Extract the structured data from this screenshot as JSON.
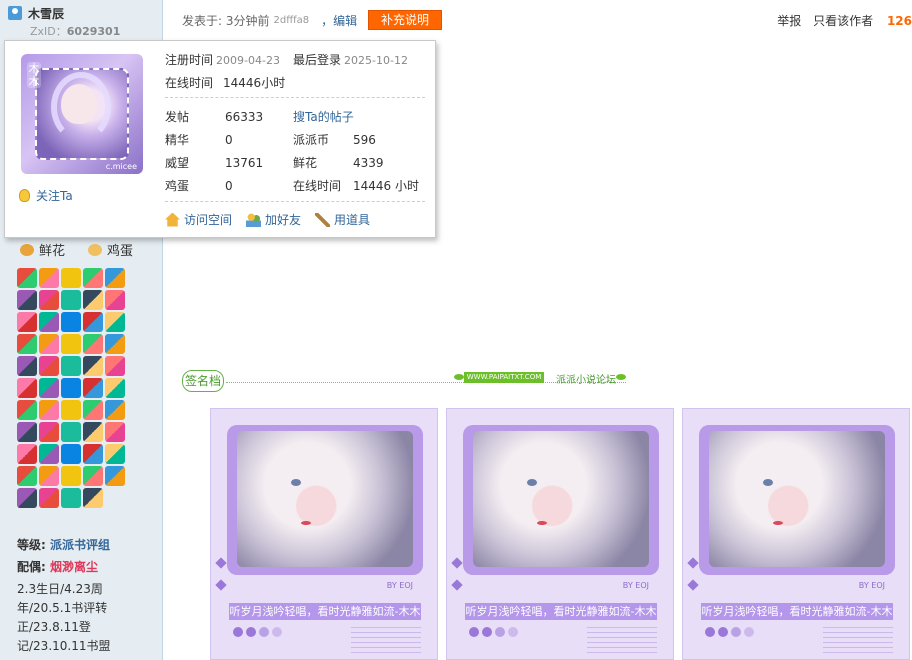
{
  "user": {
    "name": "木雪辰",
    "zxid_label": "ZxID：",
    "zxid": "6029301",
    "avatar_text": "木木",
    "avatar_caption": "c.micee",
    "follow": "关注Ta"
  },
  "profile_card": {
    "reg_label": "注册时间",
    "reg_date": "2009-04-23",
    "last_label": "最后登录",
    "last_date": "2025-10-12",
    "online_label": "在线时间",
    "online_value": "14446小时",
    "stats": [
      {
        "label": "发帖",
        "value": "66333"
      },
      {
        "label": "精华",
        "value": "0"
      },
      {
        "label": "威望",
        "value": "13761"
      },
      {
        "label": "鸡蛋",
        "value": "0"
      },
      {
        "label": "搜Ta的帖子",
        "value": ""
      },
      {
        "label": "派派币",
        "value": "596"
      },
      {
        "label": "鲜花",
        "value": "4339"
      },
      {
        "label": "在线时间",
        "value": "14446 小时"
      }
    ],
    "actions": {
      "space": "访问空间",
      "friend": "加好友",
      "tool": "用道具"
    }
  },
  "sidebar": {
    "flower": "鲜花",
    "egg": "鸡蛋",
    "level_label": "等级: ",
    "level_value": "派派书评组",
    "mate_label": "配偶: ",
    "mate_value": "烟渺离尘",
    "bio": "2.3生日/4.23周年/20.5.1书评转正/23.8.11登记/23.10.11书盟"
  },
  "post": {
    "posted": "发表于: 3分钟前",
    "hash": "2dfffa8",
    "edit": "，编辑",
    "supplement": "补充说明",
    "report": "举报",
    "only_author": "只看该作者",
    "floor": "126"
  },
  "signature": {
    "tag": "签名档",
    "site": "WWW.PAIPAITXT.COM",
    "forum": "派派小说论坛",
    "by": "BY EOJ",
    "caption": "听岁月浅吟轻唱，看时光静雅如流-木木"
  },
  "colors": {
    "link": "#336699",
    "accent": "#ff6600",
    "sidebar_bg": "#e5edf2",
    "purple": "#b497ea"
  }
}
